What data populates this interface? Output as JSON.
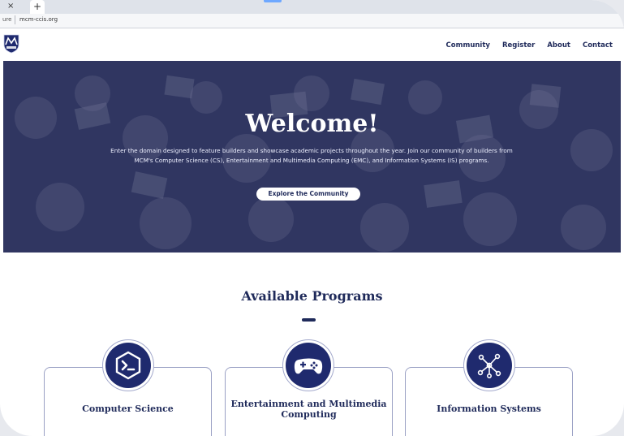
{
  "browser": {
    "tab_close": "×",
    "new_tab": "+",
    "address_prefix": "ure",
    "url": "mcm-ccis.org"
  },
  "header": {
    "logo_icon": "mcm-shield-logo-icon",
    "nav": [
      {
        "label": "Community"
      },
      {
        "label": "Register"
      },
      {
        "label": "About"
      },
      {
        "label": "Contact"
      }
    ]
  },
  "hero": {
    "title": "Welcome!",
    "description": "Enter the domain designed to feature builders and showcase academic projects throughout the year. Join our community of builders from MCM's Computer Science (CS), Entertainment and Multimedia Computing (EMC), and Information Systems (IS) programs.",
    "button_label": "Explore the Community"
  },
  "programs": {
    "title": "Available Programs",
    "cards": [
      {
        "title": "Computer Science",
        "icon": "terminal-hexagon-icon"
      },
      {
        "title": "Entertainment and Multimedia Computing",
        "icon": "gamepad-icon"
      },
      {
        "title": "Information Systems",
        "icon": "network-nodes-icon"
      }
    ]
  },
  "colors": {
    "brand_navy": "#1f2a5a",
    "icon_bg": "#1f2a6e",
    "hero_overlay": "#1c2254"
  }
}
